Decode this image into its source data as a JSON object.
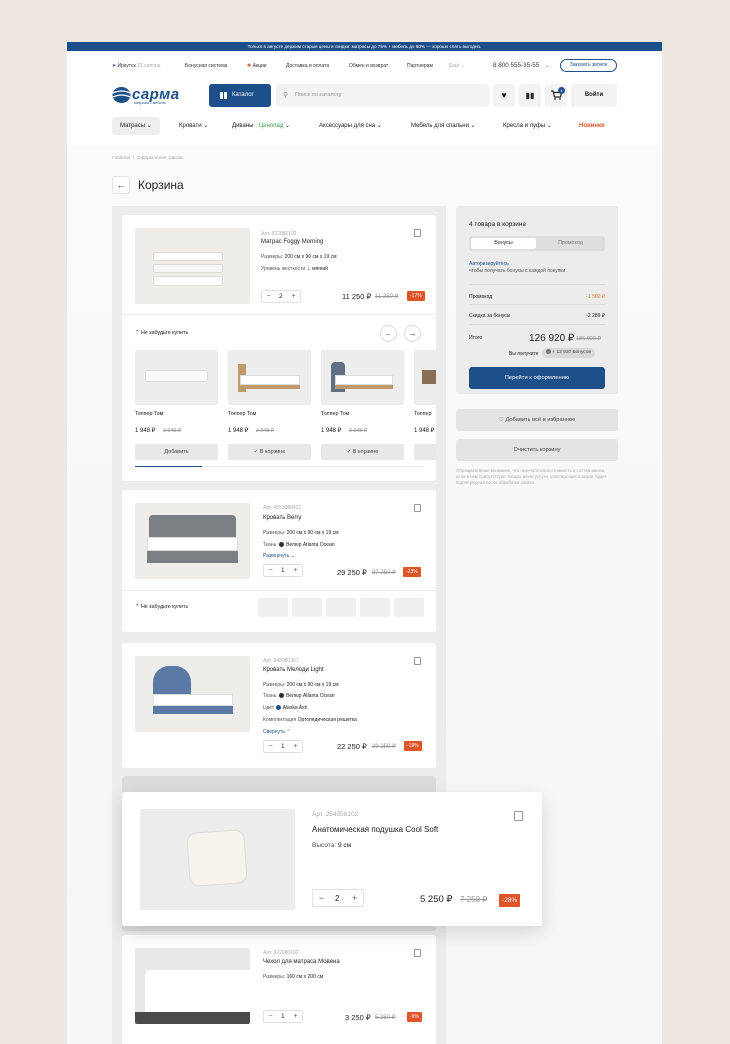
{
  "topbar": {
    "text": "Только в августе держим старые цены и скидки: матрасы до 75% + мебель до 60% — хорошо спать выгодно."
  },
  "util": {
    "city": "Иркутск",
    "salons": "23 салона",
    "bonus": "Бонусная система",
    "promo": "Акции",
    "delivery": "Доставка и оплата",
    "returns": "Обмен и возврат",
    "partners": "Партнерам",
    "more": "Ещё",
    "phone": "8 800 555-35-55",
    "call": "Заказать звонок"
  },
  "header": {
    "logo": "сарма",
    "logo_sub": "матрасы • мебель",
    "catalog": "Каталог",
    "search_placeholder": "Поиск по каталогу",
    "cart_count": "4",
    "login": "Войти"
  },
  "nav": {
    "items": [
      "Матрасы",
      "Кровати",
      "Диваны",
      "Аксессуары для сна",
      "Мебель для спальни",
      "Кресла и пуфы",
      "Новинки"
    ],
    "badge": "Ценопад"
  },
  "page": {
    "breadcrumb": [
      "Главная",
      "Оформление заказа"
    ],
    "title": "Корзина"
  },
  "labels": {
    "art": "Арт.",
    "sizes": "Размеры:",
    "firmness": "Уровень жесткости",
    "fabric": "Ткань:",
    "color": "Цвет",
    "kit": "Комплектация",
    "height": "Высота:",
    "expand": "Развернуть",
    "collapse": "Свернуть",
    "dont_forget": "Не забудьте купить",
    "add": "Добавить",
    "in_cart": "В корзине"
  },
  "items": [
    {
      "art": "822080102",
      "name": "Матрас Foggy Morning",
      "size": "200 см х 90 см х 19 см",
      "firmness": "мягкий",
      "qty": "2",
      "price": "11 250 ₽",
      "old": "11 250 ₽",
      "disc": "-17%"
    },
    {
      "art": "4553080421",
      "name": "Кровать Berry",
      "size": "200 см х 90 см х 19 см",
      "fabric": "Велюр Atlanta Ocean",
      "qty": "1",
      "price": "29 250 ₽",
      "old": "37 250 ₽",
      "disc": "-23%"
    },
    {
      "art": "948080367",
      "name": "Кровать Мелоди Light",
      "size": "200 см х 90 см х 19 см",
      "fabric": "Велюр Atlanta Ocean",
      "color": "Alaska Ash",
      "kit": "Ортопедическая решетка",
      "qty": "1",
      "price": "22 250 ₽",
      "old": "29 250 ₽",
      "disc": "-19%"
    },
    {
      "art": "254358102",
      "name": "Анатомическая подушка Cool Soft",
      "height": "9 см",
      "qty": "2",
      "price": "5 250 ₽",
      "old": "7 250 ₽",
      "disc": "-28%"
    },
    {
      "art": "822080102",
      "name": "Чехол для матраса Мовена",
      "size": "160 см х 200 см",
      "qty": "1",
      "price": "3 250 ₽",
      "old": "5 350 ₽",
      "disc": "-9%"
    }
  ],
  "recs": [
    {
      "name": "Топпер Том",
      "price": "1 948 ₽",
      "old": "3 948 ₽",
      "btn": "Добавить"
    },
    {
      "name": "Топпер Том",
      "price": "1 948 ₽",
      "old": "3 948 ₽",
      "btn": "В корзине"
    },
    {
      "name": "Топпер Том",
      "price": "1 948 ₽",
      "old": "3 948 ₽",
      "btn": "В корзине"
    },
    {
      "name": "Топпер",
      "price": "1 948 ₽"
    }
  ],
  "summary": {
    "title": "4 товара в корзине",
    "tab_bonus": "Бонусы",
    "tab_promo": "Промокод",
    "auth_link": "Авторизируйтесь",
    "auth_text": "чтобы получать бонусы с каждой покупки",
    "promo_label": "Промокод",
    "promo_val": "-1 500 ₽",
    "bonus_label": "Скидка за бонусы",
    "bonus_val": "-2 289 ₽",
    "total_label": "Итого",
    "total": "126 920 ₽",
    "total_old": "186 920 ₽",
    "get_label": "Вы получите",
    "get_val": "+ 12 920 Бонусов",
    "checkout": "Перейти к оформлению",
    "fav": "Добавить всё в избранное",
    "clear": "Очистить корзину",
    "note": "Обращаем ваше внимание, что окончательная стоимость и состав заказа, если в нем присутствуют товары и/или услуги, участвующие в акции, будет подтверждена после обработки заказа."
  },
  "colors": {
    "brand": "#1d4f8a",
    "discount": "#e0542a",
    "promo": "#e07a2a"
  }
}
